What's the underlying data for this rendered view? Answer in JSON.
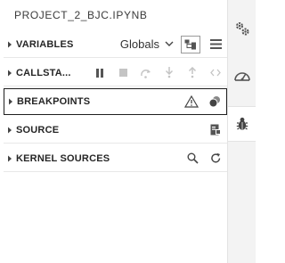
{
  "panel": {
    "title": "PROJECT_2_BJC.IPYNB"
  },
  "sections": {
    "variables": {
      "label": "VARIABLES",
      "scope_selector": "Globals",
      "icons": [
        "chevron-down-icon",
        "tree-view-icon",
        "list-view-icon"
      ]
    },
    "callstack": {
      "label": "CALLSTA...",
      "icons": [
        "pause-icon",
        "stop-icon",
        "step-over-icon",
        "step-into-icon",
        "step-out-icon",
        "code-icon"
      ]
    },
    "breakpoints": {
      "label": "BREAKPOINTS",
      "icons": [
        "warning-icon",
        "toggle-breakpoints-icon"
      ]
    },
    "source": {
      "label": "SOURCE",
      "icons": [
        "open-source-icon"
      ]
    },
    "kernel_sources": {
      "label": "KERNEL SOURCES",
      "icons": [
        "search-icon",
        "refresh-icon"
      ]
    }
  },
  "activity_bar": {
    "tabs": [
      "settings-icon",
      "dashboard-icon",
      "debugger-icon"
    ],
    "active": "debugger-icon"
  },
  "colors": {
    "panel_bg": "#ffffff",
    "activity_bg": "#f3f3f3",
    "focus_border": "#1f1f1f",
    "icon": "#555555",
    "icon_disabled": "#c4c4c4"
  }
}
